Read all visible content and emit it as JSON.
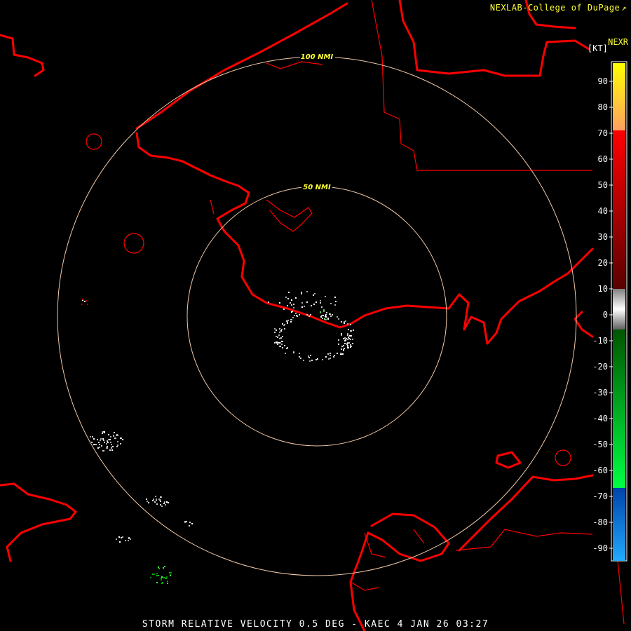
{
  "header": {
    "credit": "NEXLAB-College of DuPage",
    "credit_icon": "external-link-icon",
    "product": "NEXR",
    "unit": "[KT]"
  },
  "range_rings": [
    {
      "label": "100 NMI",
      "radius_nmi": 100
    },
    {
      "label": "50 NMI",
      "radius_nmi": 50
    }
  ],
  "colors": {
    "boundary": "#ff0000",
    "ring": "#f0c8a8",
    "ring_label": "#ffff33",
    "background": "#000000"
  },
  "legend": {
    "unit": "KT",
    "ticks": [
      "90",
      "80",
      "70",
      "60",
      "50",
      "40",
      "30",
      "20",
      "10",
      "0",
      "-10",
      "-20",
      "-30",
      "-40",
      "-50",
      "-60",
      "-70",
      "-80",
      "-90"
    ],
    "scale": [
      {
        "from": 95,
        "to": 70,
        "color_top": "#ffff00",
        "color_bottom": "#ffa060"
      },
      {
        "from": 70,
        "to": 10,
        "color_top": "#ff0000",
        "color_bottom": "#6a0000"
      },
      {
        "from": 10,
        "to": -10,
        "color_top": "#a0a0a0",
        "color_bottom": "#ffffff"
      },
      {
        "from": -10,
        "to": -65,
        "color_top": "#006600",
        "color_bottom": "#00ff44"
      },
      {
        "from": -65,
        "to": -95,
        "color_top": "#0044aa",
        "color_bottom": "#22aaff"
      }
    ]
  },
  "caption": "STORM RELATIVE VELOCITY 0.5 DEG - KAEC 4 JAN 26 03:27"
}
